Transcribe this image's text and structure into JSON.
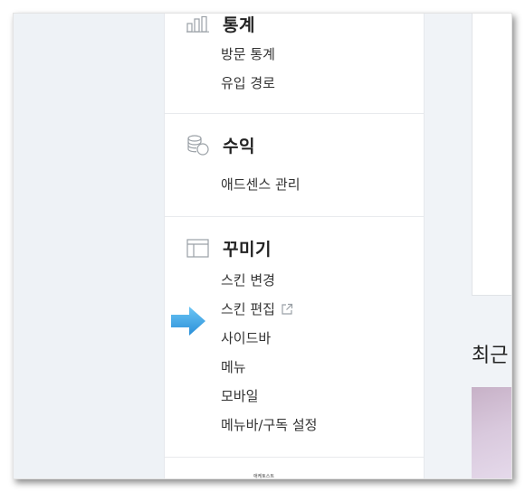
{
  "sections": {
    "stats": {
      "title": "통계",
      "icon": "bar-chart-icon",
      "items": [
        "방문 통계",
        "유입 경로"
      ]
    },
    "revenue": {
      "title": "수익",
      "icon": "coins-icon",
      "items": [
        "애드센스 관리"
      ]
    },
    "customize": {
      "title": "꾸미기",
      "icon": "layout-icon",
      "items": [
        "스킨 변경",
        "스킨 편집",
        "사이드바",
        "메뉴",
        "모바일",
        "메뉴바/구독 설정"
      ]
    }
  },
  "right": {
    "recent_heading": "최근"
  },
  "footer": {
    "tiny_label": "애케토스트"
  },
  "colors": {
    "arrow": "#3aa6e8",
    "panel_bg": "#ffffff",
    "page_bg": "#eef2f6"
  }
}
